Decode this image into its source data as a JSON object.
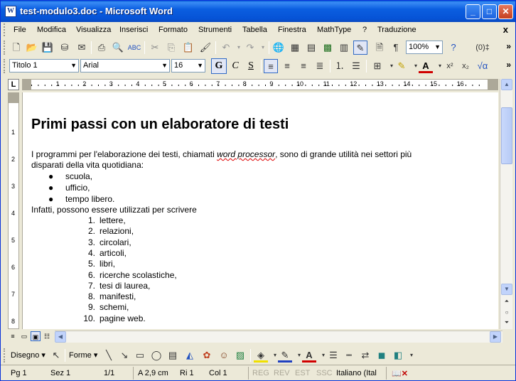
{
  "window": {
    "title": "test-modulo3.doc - Microsoft Word",
    "app_icon_letter": "W"
  },
  "title_buttons": {
    "minimize": "_",
    "maximize": "□",
    "close": "✕"
  },
  "menu": {
    "items": [
      "File",
      "Modifica",
      "Visualizza",
      "Inserisci",
      "Formato",
      "Strumenti",
      "Tabella",
      "Finestra",
      "MathType",
      "?",
      "Traduzione"
    ],
    "close_label": "x"
  },
  "toolbar_standard": {
    "zoom": "100%",
    "icons": [
      "new-document-icon",
      "open-icon",
      "save-icon",
      "permission-icon",
      "mail-icon",
      "print-icon",
      "print-preview-icon",
      "spelling-icon",
      "cut-icon",
      "copy-icon",
      "paste-icon",
      "format-painter-icon",
      "undo-icon",
      "redo-icon",
      "hyperlink-icon",
      "tables-borders-icon",
      "insert-table-icon",
      "insert-excel-icon",
      "columns-icon",
      "drawing-icon",
      "document-map-icon",
      "show-hide-icon",
      "help-icon",
      "reading-icon"
    ]
  },
  "toolbar_format": {
    "style": "Titolo 1",
    "font": "Arial",
    "size": "16",
    "bold": "G",
    "italic": "C",
    "underline": "S"
  },
  "document": {
    "heading": "Primi passi con un elaboratore di testi",
    "para1_before": "I programmi per l'elaborazione dei testi, chiamati ",
    "para1_italic": "word processor",
    "para1_after": ", sono di grande utilità nei settori più",
    "para1_line2": "disparati della vita quotidiana:",
    "bullets": [
      "scuola,",
      "ufficio,",
      "tempo libero."
    ],
    "para2": "Infatti, possono essere utilizzati per scrivere",
    "numbered": [
      {
        "n": "1.",
        "t": "lettere,"
      },
      {
        "n": "2.",
        "t": "relazioni,"
      },
      {
        "n": "3.",
        "t": "circolari,"
      },
      {
        "n": "4.",
        "t": "articoli,"
      },
      {
        "n": "5.",
        "t": "libri,"
      },
      {
        "n": "6.",
        "t": "ricerche scolastiche,"
      },
      {
        "n": "7.",
        "t": "tesi di laurea,"
      },
      {
        "n": "8.",
        "t": "manifesti,"
      },
      {
        "n": "9.",
        "t": "schemi,"
      },
      {
        "n": "10.",
        "t": "pagine web."
      }
    ]
  },
  "drawing_toolbar": {
    "draw_label": "Disegno",
    "shapes_label": "Forme"
  },
  "status": {
    "page": "Pg 1",
    "section": "Sez 1",
    "pages": "1/1",
    "at": "A 2,9 cm",
    "line": "Ri 1",
    "col": "Col 1",
    "rec": "REG",
    "trk": "REV",
    "ext": "EST",
    "ovr": "SSC",
    "language": "Italiano (Ital"
  },
  "ruler_numbers": [
    "1",
    "2",
    "3",
    "4",
    "5",
    "6",
    "7",
    "8",
    "9",
    "10",
    "11",
    "12",
    "13",
    "14",
    "15",
    "16"
  ],
  "vruler_numbers": [
    "1",
    "2",
    "3",
    "4",
    "5",
    "6",
    "7",
    "8"
  ]
}
